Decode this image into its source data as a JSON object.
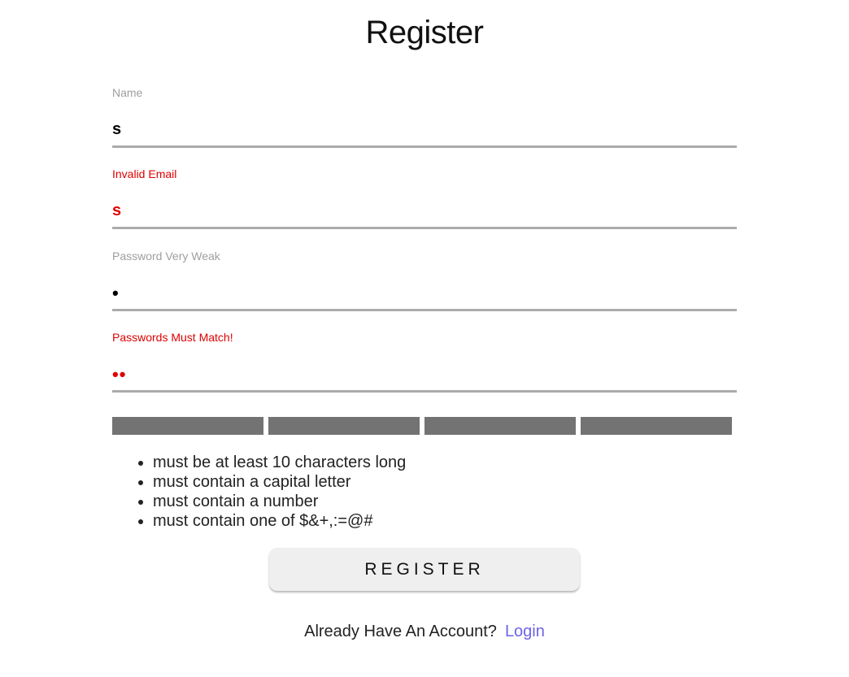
{
  "page": {
    "title": "Register"
  },
  "form": {
    "name": {
      "label": "Name",
      "value": "s"
    },
    "email": {
      "label": "Invalid Email",
      "value": "s"
    },
    "password": {
      "label": "Password Very Weak",
      "value": "•"
    },
    "confirm": {
      "label": "Passwords Must Match!",
      "value": "••"
    },
    "strength_segments": 4,
    "rules": [
      "must be at least 10 characters long",
      "must contain a capital letter",
      "must contain a number",
      "must contain one of $&+,:=@#"
    ],
    "submit_label": "REGISTER"
  },
  "footer": {
    "prompt": "Already Have An Account?",
    "link_label": "Login"
  },
  "colors": {
    "error": "#e00000",
    "label": "#9e9e9e",
    "link": "#6c63e6",
    "strength_bar": "#737373",
    "button_bg": "#efefef"
  }
}
